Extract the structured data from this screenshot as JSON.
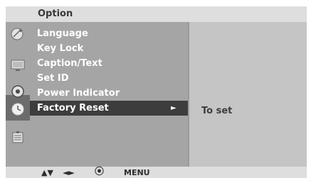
{
  "title": "Option",
  "menu": {
    "items": [
      {
        "label": "Language"
      },
      {
        "label": "Key Lock"
      },
      {
        "label": "Caption/Text"
      },
      {
        "label": "Set ID"
      },
      {
        "label": "Power Indicator"
      },
      {
        "label": "Factory Reset",
        "selected": true
      }
    ],
    "selected_arrow": "►"
  },
  "detail": {
    "text": "To set"
  },
  "icons": [
    "satellite-dish-icon",
    "screen-icon",
    "audio-icon",
    "clock-icon",
    "option-icon"
  ],
  "footer": {
    "updown": "▲▼",
    "leftright": "◄►",
    "ok_symbol": "⦿",
    "menu_label": "MENU"
  },
  "colors": {
    "title_bar": "#dedede",
    "menu_bg": "#a5a5a5",
    "selected_bg": "#3d3d3d",
    "detail_bg": "#c5c5c5"
  }
}
